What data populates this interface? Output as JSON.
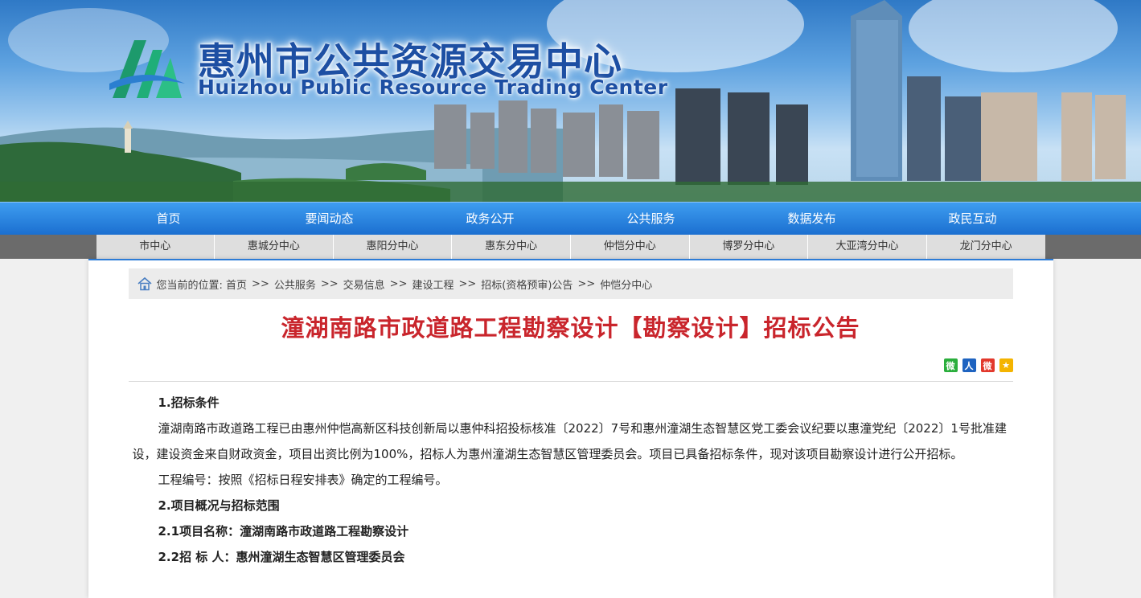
{
  "header": {
    "title_cn": "惠州市公共资源交易中心",
    "title_en": "Huizhou Public Resource Trading Center",
    "logo_icon": "huizhou-logo-icon"
  },
  "main_nav": [
    "首页",
    "要闻动态",
    "政务公开",
    "公共服务",
    "数据发布",
    "政民互动"
  ],
  "sub_nav": [
    "市中心",
    "惠城分中心",
    "惠阳分中心",
    "惠东分中心",
    "仲恺分中心",
    "博罗分中心",
    "大亚湾分中心",
    "龙门分中心"
  ],
  "breadcrumb": {
    "prefix": "您当前的位置:",
    "separator": ">>",
    "items": [
      "首页",
      "公共服务",
      "交易信息",
      "建设工程",
      "招标(资格预审)公告",
      "仲恺分中心"
    ]
  },
  "article": {
    "title": "潼湖南路市政道路工程勘察设计【勘察设计】招标公告",
    "share_icons": [
      {
        "name": "wechat-share-icon",
        "glyph": "微",
        "color": "#2aae3c"
      },
      {
        "name": "renren-share-icon",
        "glyph": "人",
        "color": "#1e63c0"
      },
      {
        "name": "weibo-share-icon",
        "glyph": "微",
        "color": "#e2382c"
      },
      {
        "name": "qzone-share-icon",
        "glyph": "★",
        "color": "#f4b400"
      }
    ],
    "paragraphs": [
      {
        "type": "heading",
        "text": "1.招标条件"
      },
      {
        "type": "text",
        "text": "潼湖南路市政道路工程已由惠州仲恺高新区科技创新局以惠仲科招投标核准〔2022〕7号和惠州潼湖生态智慧区党工委会议纪要以惠潼党纪〔2022〕1号批准建设，建设资金来自财政资金，项目出资比例为100%，招标人为惠州潼湖生态智慧区管理委员会。项目已具备招标条件，现对该项目勘察设计进行公开招标。"
      },
      {
        "type": "text",
        "text": "工程编号：按照《招标日程安排表》确定的工程编号。"
      },
      {
        "type": "heading",
        "text": "2.项目概况与招标范围"
      },
      {
        "type": "heading",
        "text": "2.1项目名称：潼湖南路市政道路工程勘察设计"
      },
      {
        "type": "heading",
        "text": "2.2招 标 人：惠州潼湖生态智慧区管理委员会"
      }
    ]
  }
}
